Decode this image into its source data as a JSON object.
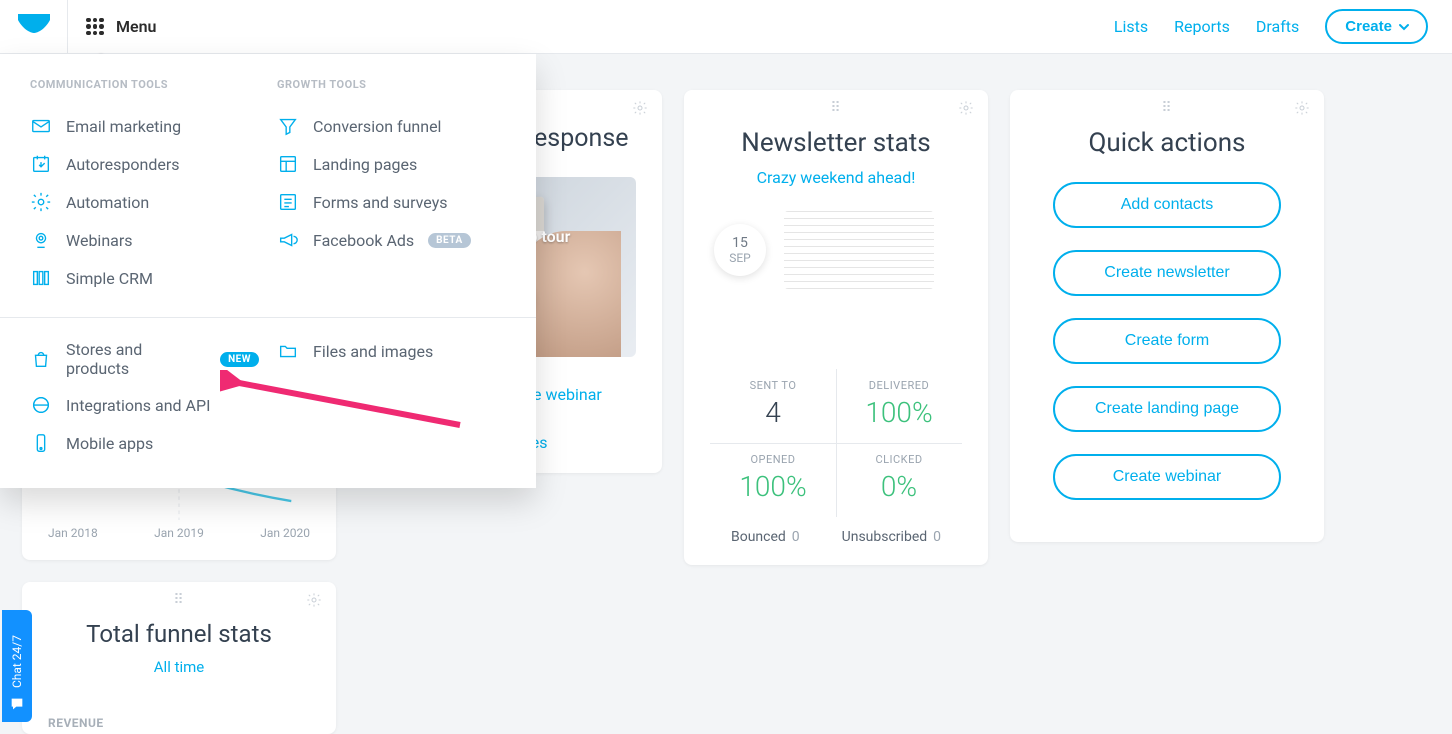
{
  "header": {
    "menu_label": "Menu",
    "links": {
      "lists": "Lists",
      "reports": "Reports",
      "drafts": "Drafts"
    },
    "create_label": "Create"
  },
  "mega_menu": {
    "heading_comm": "COMMUNICATION TOOLS",
    "heading_growth": "GROWTH TOOLS",
    "comm": {
      "email": "Email marketing",
      "autoresponders": "Autoresponders",
      "automation": "Automation",
      "webinars": "Webinars",
      "crm": "Simple CRM"
    },
    "growth": {
      "funnel": "Conversion funnel",
      "landing": "Landing pages",
      "forms": "Forms and surveys",
      "facebook": "Facebook Ads",
      "facebook_badge": "BETA"
    },
    "other": {
      "stores": "Stores and products",
      "stores_badge": "NEW",
      "integrations": "Integrations and API",
      "mobile": "Mobile apps",
      "files": "Files and images"
    }
  },
  "explore": {
    "title": "Explore GetResponse",
    "video_caption": "Watch video tour",
    "webinar_link": "Sign up for a free webinar",
    "resources_link": "Browse resources"
  },
  "newsletter": {
    "title": "Newsletter stats",
    "subtitle": "Crazy weekend ahead!",
    "date_day": "15",
    "date_month": "SEP",
    "sent_to_label": "SENT TO",
    "sent_to_val": "4",
    "delivered_label": "DELIVERED",
    "delivered_val": "100%",
    "opened_label": "OPENED",
    "opened_val": "100%",
    "clicked_label": "CLICKED",
    "clicked_val": "0%",
    "bounced_label": "Bounced",
    "bounced_val": "0",
    "unsub_label": "Unsubscribed",
    "unsub_val": "0"
  },
  "quick_actions": {
    "title": "Quick actions",
    "buttons": {
      "add_contacts": "Add contacts",
      "create_newsletter": "Create newsletter",
      "create_form": "Create form",
      "create_landing": "Create landing page",
      "create_webinar": "Create webinar"
    }
  },
  "list_growth": {
    "labels": {
      "a": "Jan 2018",
      "b": "Jan 2019",
      "c": "Jan 2020"
    }
  },
  "funnel": {
    "title": "Total funnel stats",
    "subtitle": "All time",
    "revenue_label": "REVENUE"
  },
  "chat": {
    "label": "Chat 24/7"
  },
  "chart_data": {
    "type": "line",
    "title": "",
    "xlabel": "",
    "ylabel": "",
    "x": [
      "Jan 2018",
      "Jan 2019",
      "Jan 2020"
    ],
    "values": [
      70,
      40,
      20
    ],
    "ylim": [
      0,
      100
    ]
  }
}
